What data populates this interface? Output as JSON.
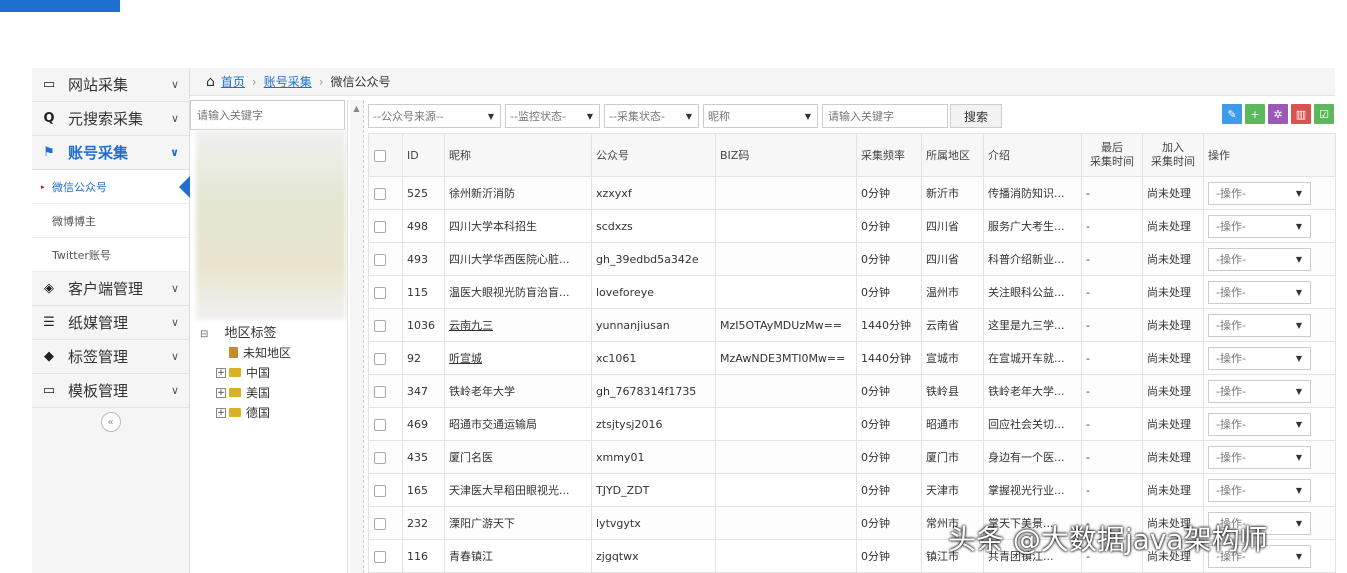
{
  "sidebar": {
    "items": [
      {
        "label": "网站采集",
        "icon": "monitor-icon"
      },
      {
        "label": "元搜索采集",
        "icon": "search-icon"
      },
      {
        "label": "账号采集",
        "icon": "flag-icon",
        "active": true
      },
      {
        "label": "客户端管理",
        "icon": "eye-slash-icon"
      },
      {
        "label": "纸媒管理",
        "icon": "newspaper-icon"
      },
      {
        "label": "标签管理",
        "icon": "tag-icon"
      },
      {
        "label": "模板管理",
        "icon": "monitor-icon"
      }
    ],
    "sub_items": [
      "微信公众号",
      "微博博主",
      "Twitter账号"
    ],
    "collapse": "«"
  },
  "breadcrumb": {
    "home": "首页",
    "section": "账号采集",
    "current": "微信公众号"
  },
  "tree": {
    "search_placeholder": "请输入关键字",
    "root": "地区标签",
    "nodes": [
      "未知地区",
      "中国",
      "美国",
      "德国"
    ]
  },
  "filters": {
    "source": "--公众号来源--",
    "monitor": "--监控状态-",
    "collect": "--采集状态-",
    "nickname": "昵称",
    "keyword_placeholder": "请输入关键字",
    "search": "搜索"
  },
  "toolbar": {
    "colors": [
      "#3e9be8",
      "#5cb85c",
      "#9b59b6",
      "#d9534f",
      "#5cb85c"
    ]
  },
  "table": {
    "headers": [
      "ID",
      "昵称",
      "公众号",
      "BIZ码",
      "采集频率",
      "所属地区",
      "介绍",
      "最后\n采集时间",
      "加入\n采集时间",
      "操作"
    ],
    "op_label": "-操作-",
    "rows": [
      [
        "525",
        "徐州新沂消防",
        "xzxyxf",
        "",
        "0分钟",
        "新沂市",
        "传播消防知识...",
        "-",
        "尚未处理"
      ],
      [
        "498",
        "四川大学本科招生",
        "scdxzs",
        "",
        "0分钟",
        "四川省",
        "服务广大考生...",
        "-",
        "尚未处理"
      ],
      [
        "493",
        "四川大学华西医院心脏...",
        "gh_39edbd5a342e",
        "",
        "0分钟",
        "四川省",
        "科普介绍新业...",
        "-",
        "尚未处理"
      ],
      [
        "115",
        "温医大眼视光防盲治盲...",
        "loveforeye",
        "",
        "0分钟",
        "温州市",
        "关注眼科公益...",
        "-",
        "尚未处理"
      ],
      [
        "1036",
        "云南九三",
        "yunnanjiusan",
        "MzI5OTAyMDUzMw==",
        "1440分钟",
        "云南省",
        "这里是九三学...",
        "-",
        "尚未处理"
      ],
      [
        "92",
        "听宣城",
        "xc1061",
        "MzAwNDE3MTI0Mw==",
        "1440分钟",
        "宣城市",
        "在宣城开车就...",
        "-",
        "尚未处理"
      ],
      [
        "347",
        "铁岭老年大学",
        "gh_7678314f1735",
        "",
        "0分钟",
        "铁岭县",
        "铁岭老年大学...",
        "-",
        "尚未处理"
      ],
      [
        "469",
        "昭通市交通运输局",
        "ztsjtysj2016",
        "",
        "0分钟",
        "昭通市",
        "回应社会关切...",
        "-",
        "尚未处理"
      ],
      [
        "435",
        "厦门名医",
        "xmmy01",
        "",
        "0分钟",
        "厦门市",
        "身边有一个医...",
        "-",
        "尚未处理"
      ],
      [
        "165",
        "天津医大早稻田眼视光...",
        "TJYD_ZDT",
        "",
        "0分钟",
        "天津市",
        "掌握视光行业...",
        "-",
        "尚未处理"
      ],
      [
        "232",
        "溧阳广游天下",
        "lytvgytx",
        "",
        "0分钟",
        "常州市",
        "掌天下美景...",
        "-",
        "尚未处理"
      ],
      [
        "116",
        "青春镇江",
        "zjgqtwx",
        "",
        "0分钟",
        "镇江市",
        "共青团镇江...",
        "-",
        "尚未处理"
      ]
    ],
    "linked_rows": [
      4,
      5
    ]
  },
  "watermark": "头条 @大数据java架构师"
}
